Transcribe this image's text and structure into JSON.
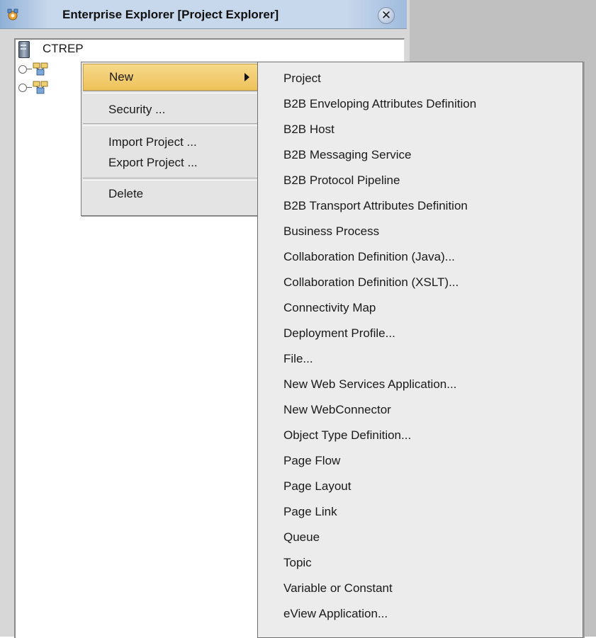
{
  "panel": {
    "title": "Enterprise Explorer [Project Explorer]",
    "close_glyph": "✕",
    "icons": {
      "title": "explorer-icon",
      "close": "close-icon"
    }
  },
  "tree": {
    "root_label": "CTREP",
    "root_icon": "server-icon",
    "child_icon": "project-icon"
  },
  "context_menu": {
    "items": [
      {
        "label": "New",
        "has_submenu": true
      },
      {
        "label": "Security ..."
      },
      {
        "label": "Import Project ..."
      },
      {
        "label": "Export Project ..."
      },
      {
        "label": "Delete"
      }
    ]
  },
  "submenu": {
    "items": [
      "Project",
      "B2B Enveloping Attributes Definition",
      "B2B Host",
      "B2B Messaging Service",
      "B2B Protocol Pipeline",
      "B2B Transport Attributes Definition",
      "Business Process",
      "Collaboration Definition (Java)...",
      "Collaboration Definition (XSLT)...",
      "Connectivity Map",
      "Deployment Profile...",
      "File...",
      "New Web Services Application...",
      "New WebConnector",
      "Object Type Definition...",
      "Page Flow",
      "Page Layout",
      "Page Link",
      "Queue",
      "Topic",
      "Variable or Constant",
      "eView Application..."
    ]
  },
  "colors": {
    "highlight": "#eec25a",
    "menu_bg": "#e4e4e4",
    "titlebar": "#c8d8ec"
  }
}
